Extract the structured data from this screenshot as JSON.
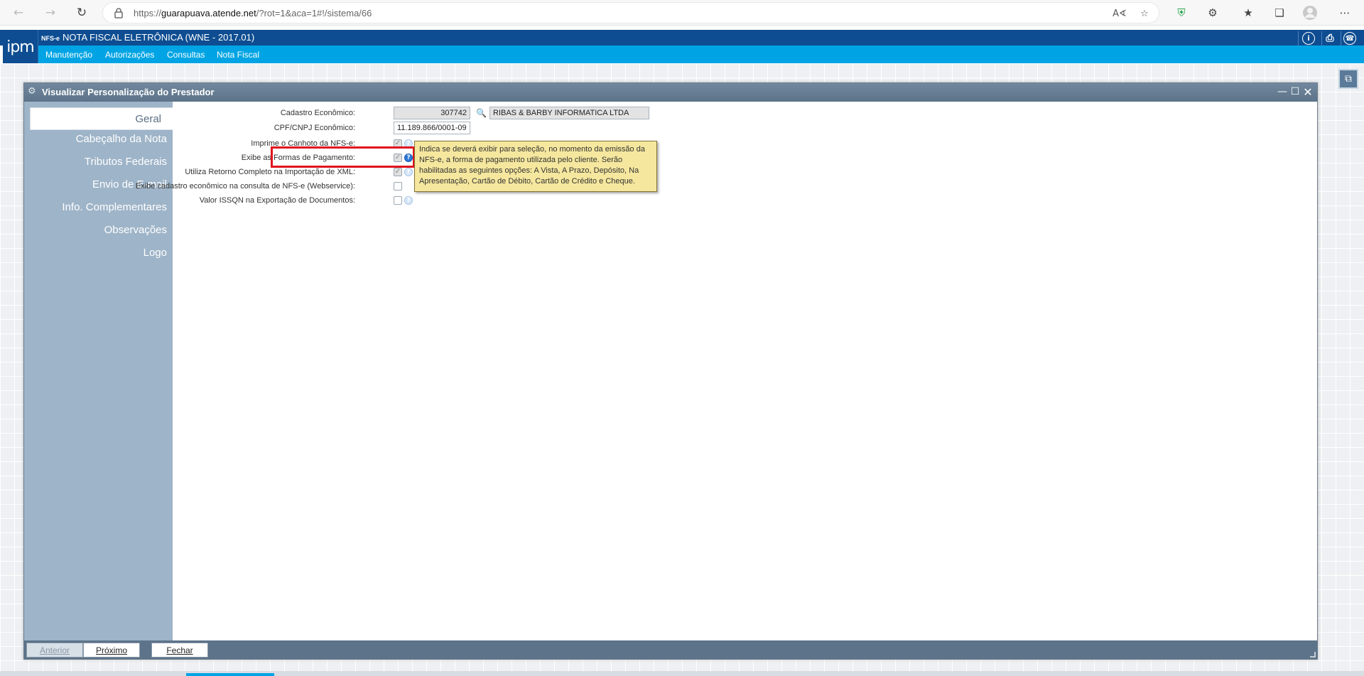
{
  "browser": {
    "url_prefix": "https://",
    "url_host": "guarapuava.atende.net",
    "url_path": "/?rot=1&aca=1#!/sistema/66"
  },
  "app": {
    "logo_text": "ipm",
    "title_prefix": "NFS-e",
    "title": "NOTA FISCAL ELETRÔNICA (WNE - 2017.01)",
    "menu": [
      "Manutenção",
      "Autorizações",
      "Consultas",
      "Nota Fiscal"
    ]
  },
  "dialog": {
    "title": "Visualizar Personalização do Prestador",
    "sidebar": [
      {
        "label": "Geral",
        "active": true
      },
      {
        "label": "Cabeçalho da Nota",
        "active": false
      },
      {
        "label": "Tributos Federais",
        "active": false
      },
      {
        "label": "Envio de E-mail",
        "active": false
      },
      {
        "label": "Info. Complementares",
        "active": false
      },
      {
        "label": "Observações",
        "active": false
      },
      {
        "label": "Logo",
        "active": false
      }
    ],
    "fields": {
      "cadastro_label": "Cadastro Econômico:",
      "cadastro_value": "307742",
      "cadastro_name": "RIBAS & BARBY INFORMATICA LTDA",
      "cpf_label": "CPF/CNPJ Econômico:",
      "cpf_value": "11.189.866/0001-09",
      "imprime_label": "Imprime o Canhoto da NFS-e:",
      "exibe_formas_label": "Exibe as Formas de Pagamento:",
      "utiliza_retorno_label": "Utiliza Retorno Completo na Importação de XML:",
      "exibe_cadastro_label": "Exibe cadastro econômico na consulta de NFS-e (Webservice):",
      "valor_issqn_label": "Valor ISSQN na Exportação de Documentos:"
    },
    "tooltip": "Indica se deverá exibir para seleção, no momento da emissão da NFS-e, a forma de pagamento utilizada pelo cliente. Serão habilitadas as seguintes opções: A Vista, A Prazo, Depósito, Na Apresentação, Cartão de Débito, Cartão de Crédito e Cheque.",
    "footer": {
      "anterior": "Anterior",
      "proximo": "Próximo",
      "fechar": "Fechar"
    }
  }
}
